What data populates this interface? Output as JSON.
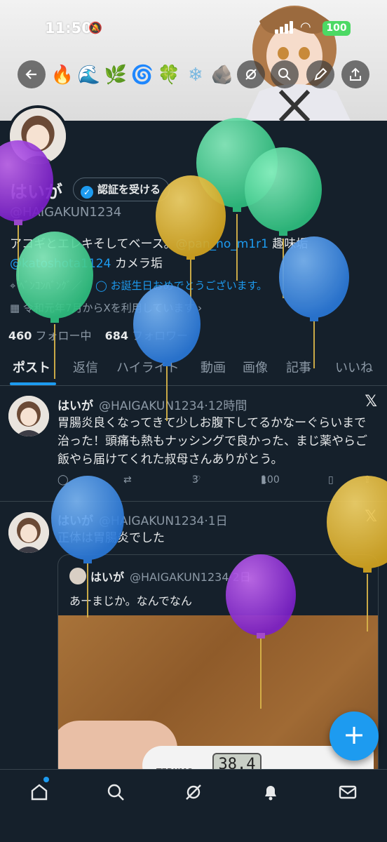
{
  "status_bar": {
    "time": "11:50",
    "battery": "100"
  },
  "header": {
    "element_icons": [
      "🔥",
      "🌊",
      "🌿",
      "🌀",
      "🍀",
      "❄",
      "🪨"
    ]
  },
  "profile": {
    "name": "はいが",
    "verify_label": "認証を受ける",
    "handle": "@HAIGAKUN1234",
    "bio_line1": "アコギとエレキそしてベース。",
    "bio_mention1": "@pan_no_m1r1",
    "bio_tail1": " 趣味垢",
    "bio_mention2": "@katoshota1124",
    "bio_tail2": " カメラ垢",
    "location": "ﾍﾞﾝｺﾝﾊﾞﾝｸﾞ／",
    "birthday": "お誕生日おめでとうございます。",
    "joined": "令和元年7月からXを利用しています",
    "following_count": "460",
    "following_label": "フォロー中",
    "followers_count": "684",
    "followers_label": "フォロワー"
  },
  "tabs": [
    "ポスト",
    "返信",
    "ハイライト",
    "動画",
    "画像",
    "記事",
    "いいね"
  ],
  "posts": [
    {
      "name": "はいが",
      "meta": "@HAIGAKUN1234·12時間",
      "text": "胃腸炎良くなってきて少しお腹下してるかなーぐらいまで治った！頭痛も熱もナッシングで良かった、まじ薬やらご飯やら届けてくれた叔母さんありがとう。",
      "likes": "3",
      "views": "100"
    },
    {
      "name": "はいが",
      "meta": "@HAIGAKUN1234·1日",
      "text": "正体は胃腸炎でした",
      "quote": {
        "name": "はいが",
        "meta": "@HAIGAKUN1234·2日",
        "text": "あーまじか。なんでなん",
        "thermometer_reading": "38.4",
        "thermometer_brand": "TERUMO"
      }
    }
  ],
  "colors": {
    "accent": "#1d9bf0",
    "background": "#15202b"
  },
  "icons": {
    "back": "arrow-left-icon",
    "grok": "grok-icon",
    "search": "search-icon",
    "edit": "pen-icon",
    "share": "share-icon",
    "compose": "plus-icon",
    "nav": [
      "home-icon",
      "search-icon",
      "grok-icon",
      "bell-icon",
      "mail-icon"
    ]
  }
}
